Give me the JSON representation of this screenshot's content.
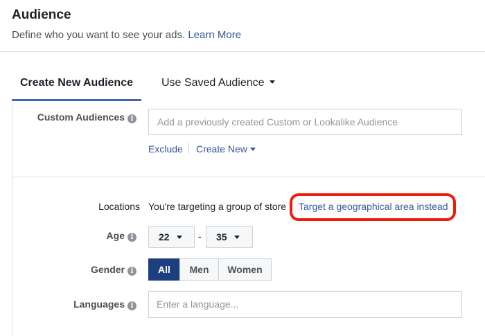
{
  "header": {
    "title": "Audience",
    "subtitle": "Define who you want to see your ads.",
    "learn_more": "Learn More"
  },
  "tabs": [
    {
      "label": "Create New Audience",
      "active": true
    },
    {
      "label": "Use Saved Audience",
      "active": false
    }
  ],
  "custom_audiences": {
    "label": "Custom Audiences",
    "placeholder": "Add a previously created Custom or Lookalike Audience",
    "exclude": "Exclude",
    "create_new": "Create New"
  },
  "locations": {
    "label": "Locations",
    "text": "You're targeting a group of store",
    "link": "Target a geographical area instead"
  },
  "age": {
    "label": "Age",
    "min": "22",
    "separator": "-",
    "max": "35"
  },
  "gender": {
    "label": "Gender",
    "options": [
      "All",
      "Men",
      "Women"
    ],
    "selected": "All"
  },
  "languages": {
    "label": "Languages",
    "placeholder": "Enter a language..."
  },
  "colors": {
    "link": "#365899",
    "tab_accent": "#4267b2",
    "active_segment": "#1d3f80",
    "highlight": "#ee1c0a"
  }
}
